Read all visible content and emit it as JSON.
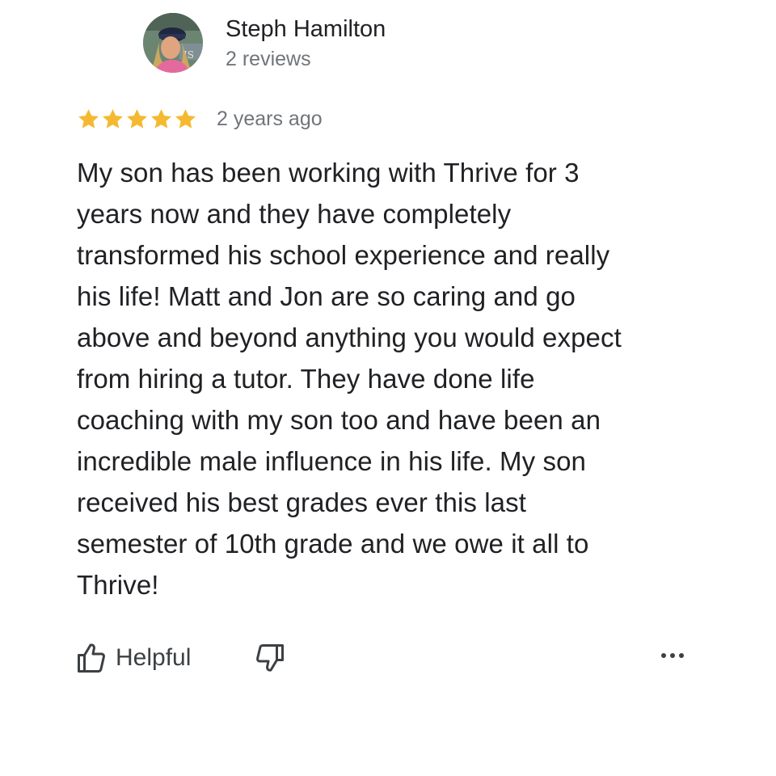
{
  "reviewer": {
    "name": "Steph Hamilton",
    "review_count": "2 reviews",
    "avatar_icon": "user-photo-avatar"
  },
  "rating": {
    "stars": 5,
    "max": 5,
    "color": "#F5B931",
    "icon": "star-icon"
  },
  "time": "2 years ago",
  "review": {
    "lines": [
      "My son has been working with Thrive for 3",
      "years now and they have completely",
      "transformed his school experience and really",
      "his life! Matt and Jon are so caring and go",
      "above and beyond anything you would expect",
      "from hiring a tutor. They have done life",
      "coaching with my son too and have been an",
      "incredible male influence in his life. My son",
      "received his best grades ever this last",
      "semester of 10th grade and we owe it all to",
      "Thrive!"
    ]
  },
  "actions": {
    "helpful_label": "Helpful",
    "helpful_icon": "thumbs-up-icon",
    "not_helpful_icon": "thumbs-down-icon",
    "more_icon": "more-options-icon"
  },
  "colors": {
    "text_primary": "#202124",
    "text_secondary": "#70757A",
    "star": "#F5B931"
  }
}
